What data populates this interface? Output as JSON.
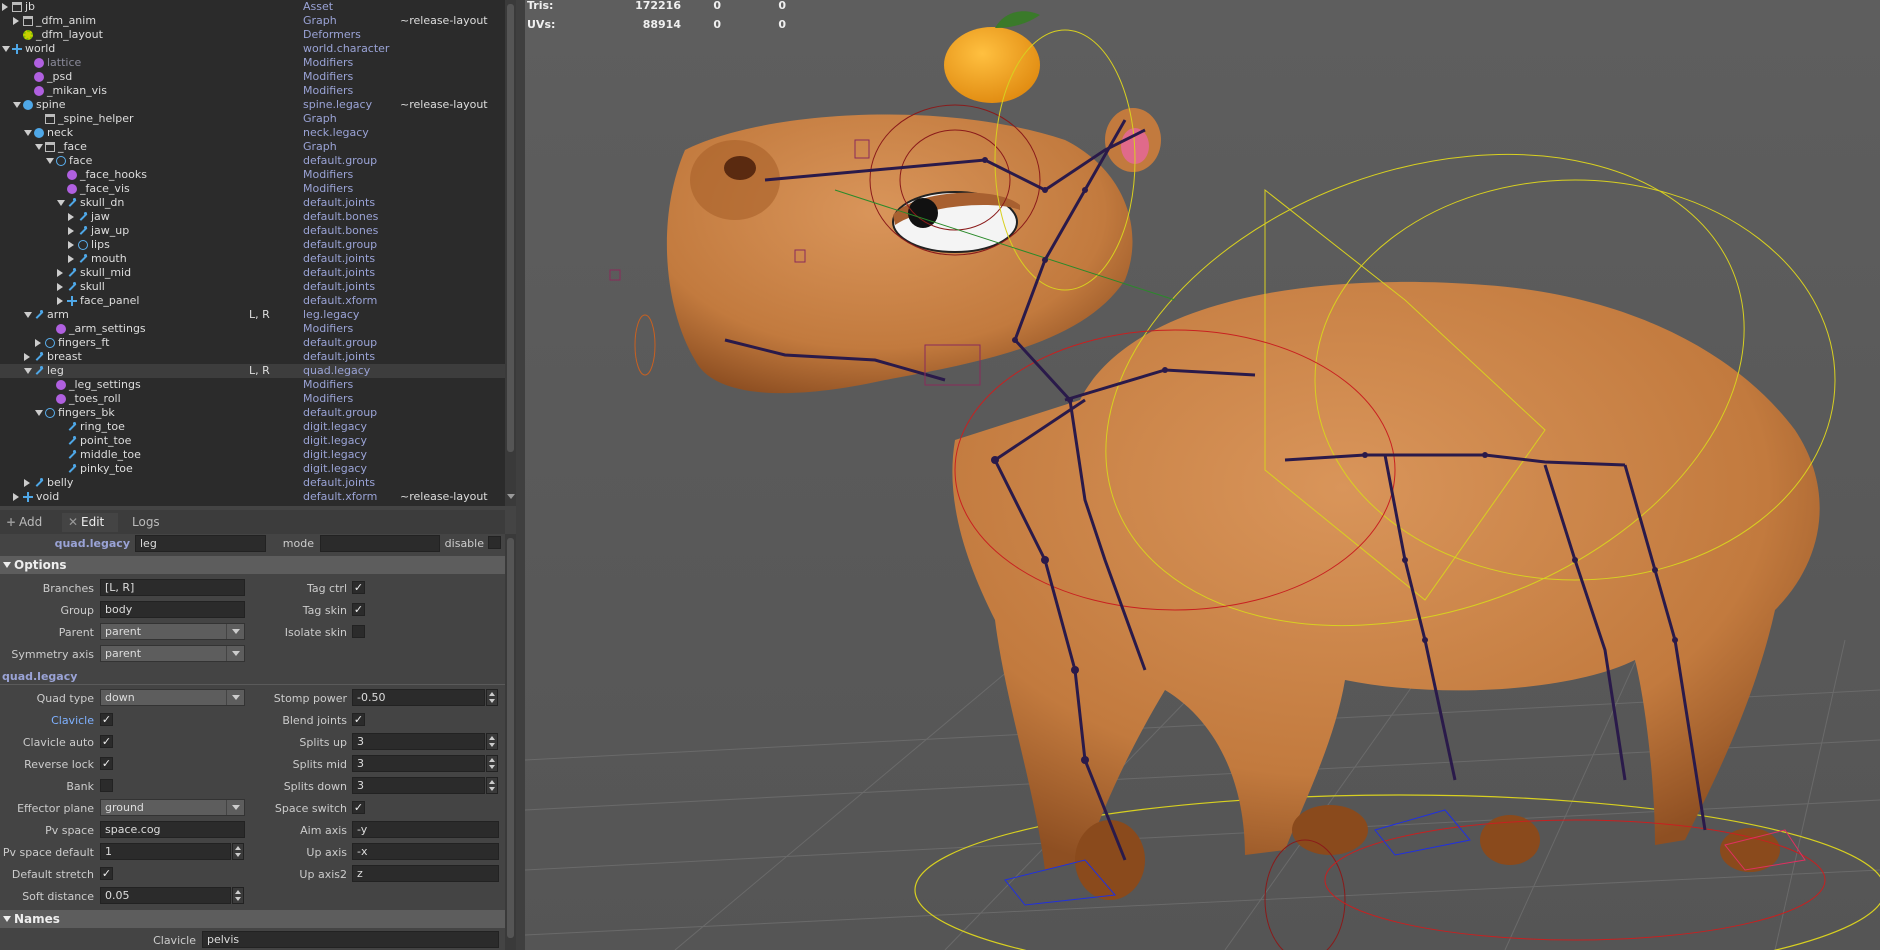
{
  "outliner": {
    "rows": [
      {
        "indent": 0,
        "tri": "closed",
        "icon": "graph",
        "name": "jb",
        "type": "Asset",
        "branches": "",
        "tag": ""
      },
      {
        "indent": 1,
        "tri": "closed",
        "icon": "graph",
        "name": "_dfm_anim",
        "type": "Graph",
        "branches": "",
        "tag": "~release-layout"
      },
      {
        "indent": 1,
        "tri": "none",
        "icon": "deform",
        "name": "_dfm_layout",
        "type": "Deformers",
        "branches": "",
        "tag": ""
      },
      {
        "indent": 0,
        "tri": "open",
        "icon": "world",
        "name": "world",
        "type": "world.character",
        "branches": "",
        "tag": ""
      },
      {
        "indent": 2,
        "tri": "none",
        "icon": "gear",
        "name": "lattice",
        "type": "Modifiers",
        "branches": "",
        "tag": "",
        "dim": true
      },
      {
        "indent": 2,
        "tri": "none",
        "icon": "gear",
        "name": "_psd",
        "type": "Modifiers",
        "branches": "",
        "tag": ""
      },
      {
        "indent": 2,
        "tri": "none",
        "icon": "gear",
        "name": "_mikan_vis",
        "type": "Modifiers",
        "branches": "",
        "tag": ""
      },
      {
        "indent": 1,
        "tri": "open",
        "icon": "spine",
        "name": "spine",
        "type": "spine.legacy",
        "branches": "",
        "tag": "~release-layout"
      },
      {
        "indent": 3,
        "tri": "none",
        "icon": "graph",
        "name": "_spine_helper",
        "type": "Graph",
        "branches": "",
        "tag": ""
      },
      {
        "indent": 2,
        "tri": "open",
        "icon": "spine",
        "name": "neck",
        "type": "neck.legacy",
        "branches": "",
        "tag": ""
      },
      {
        "indent": 3,
        "tri": "open",
        "icon": "graph",
        "name": "_face",
        "type": "Graph",
        "branches": "",
        "tag": ""
      },
      {
        "indent": 4,
        "tri": "open",
        "icon": "group",
        "name": "face",
        "type": "default.group",
        "branches": "",
        "tag": ""
      },
      {
        "indent": 5,
        "tri": "none",
        "icon": "gear",
        "name": "_face_hooks",
        "type": "Modifiers",
        "branches": "",
        "tag": ""
      },
      {
        "indent": 5,
        "tri": "none",
        "icon": "gear",
        "name": "_face_vis",
        "type": "Modifiers",
        "branches": "",
        "tag": ""
      },
      {
        "indent": 5,
        "tri": "open",
        "icon": "joint",
        "name": "skull_dn",
        "type": "default.joints",
        "branches": "",
        "tag": ""
      },
      {
        "indent": 6,
        "tri": "closed",
        "icon": "joint",
        "name": "jaw",
        "type": "default.bones",
        "branches": "",
        "tag": ""
      },
      {
        "indent": 6,
        "tri": "closed",
        "icon": "joint",
        "name": "jaw_up",
        "type": "default.bones",
        "branches": "",
        "tag": ""
      },
      {
        "indent": 6,
        "tri": "closed",
        "icon": "group",
        "name": "lips",
        "type": "default.group",
        "branches": "",
        "tag": ""
      },
      {
        "indent": 6,
        "tri": "closed",
        "icon": "joint",
        "name": "mouth",
        "type": "default.joints",
        "branches": "",
        "tag": ""
      },
      {
        "indent": 5,
        "tri": "closed",
        "icon": "joint",
        "name": "skull_mid",
        "type": "default.joints",
        "branches": "",
        "tag": ""
      },
      {
        "indent": 5,
        "tri": "closed",
        "icon": "joint",
        "name": "skull",
        "type": "default.joints",
        "branches": "",
        "tag": ""
      },
      {
        "indent": 5,
        "tri": "closed",
        "icon": "xform",
        "name": "face_panel",
        "type": "default.xform",
        "branches": "",
        "tag": ""
      },
      {
        "indent": 2,
        "tri": "open",
        "icon": "joint",
        "name": "arm",
        "type": "leg.legacy",
        "branches": "L, R",
        "tag": ""
      },
      {
        "indent": 4,
        "tri": "none",
        "icon": "gear",
        "name": "_arm_settings",
        "type": "Modifiers",
        "branches": "",
        "tag": ""
      },
      {
        "indent": 3,
        "tri": "closed",
        "icon": "group",
        "name": "fingers_ft",
        "type": "default.group",
        "branches": "",
        "tag": ""
      },
      {
        "indent": 2,
        "tri": "closed",
        "icon": "joint",
        "name": "breast",
        "type": "default.joints",
        "branches": "",
        "tag": ""
      },
      {
        "indent": 2,
        "tri": "open",
        "icon": "joint",
        "name": "leg",
        "type": "quad.legacy",
        "branches": "L, R",
        "tag": "",
        "selected": true
      },
      {
        "indent": 4,
        "tri": "none",
        "icon": "gear",
        "name": "_leg_settings",
        "type": "Modifiers",
        "branches": "",
        "tag": ""
      },
      {
        "indent": 4,
        "tri": "none",
        "icon": "gear",
        "name": "_toes_roll",
        "type": "Modifiers",
        "branches": "",
        "tag": ""
      },
      {
        "indent": 3,
        "tri": "open",
        "icon": "group",
        "name": "fingers_bk",
        "type": "default.group",
        "branches": "",
        "tag": ""
      },
      {
        "indent": 5,
        "tri": "none",
        "icon": "joint",
        "name": "ring_toe",
        "type": "digit.legacy",
        "branches": "",
        "tag": ""
      },
      {
        "indent": 5,
        "tri": "none",
        "icon": "joint",
        "name": "point_toe",
        "type": "digit.legacy",
        "branches": "",
        "tag": ""
      },
      {
        "indent": 5,
        "tri": "none",
        "icon": "joint",
        "name": "middle_toe",
        "type": "digit.legacy",
        "branches": "",
        "tag": ""
      },
      {
        "indent": 5,
        "tri": "none",
        "icon": "joint",
        "name": "pinky_toe",
        "type": "digit.legacy",
        "branches": "",
        "tag": ""
      },
      {
        "indent": 2,
        "tri": "closed",
        "icon": "joint",
        "name": "belly",
        "type": "default.joints",
        "branches": "",
        "tag": ""
      },
      {
        "indent": 1,
        "tri": "closed",
        "icon": "xform",
        "name": "void",
        "type": "default.xform",
        "branches": "",
        "tag": "~release-layout"
      }
    ]
  },
  "tabs": {
    "add": "Add",
    "edit": "Edit",
    "logs": "Logs"
  },
  "header": {
    "type": "quad.legacy",
    "name": "leg",
    "mode_label": "mode",
    "mode_value": "",
    "disable_label": "disable"
  },
  "options": {
    "title": "Options",
    "branches_label": "Branches",
    "branches_value": "[L, R]",
    "group_label": "Group",
    "group_value": "body",
    "parent_label": "Parent",
    "parent_value": "parent",
    "symmetry_label": "Symmetry axis",
    "symmetry_value": "parent",
    "tag_ctrl_label": "Tag ctrl",
    "tag_skin_label": "Tag skin",
    "isolate_skin_label": "Isolate skin",
    "tag_ctrl": true,
    "tag_skin": true,
    "isolate_skin": false
  },
  "quad": {
    "title": "quad.legacy",
    "quad_type_label": "Quad type",
    "quad_type_value": "down",
    "clavicle_label": "Clavicle",
    "clavicle_auto_label": "Clavicle auto",
    "reverse_lock_label": "Reverse lock",
    "bank_label": "Bank",
    "effector_plane_label": "Effector plane",
    "effector_plane_value": "ground",
    "pv_space_label": "Pv space",
    "pv_space_value": "space.cog",
    "pv_space_default_label": "Pv space default",
    "pv_space_default_value": "1",
    "default_stretch_label": "Default stretch",
    "soft_distance_label": "Soft distance",
    "soft_distance_value": "0.05",
    "stomp_power_label": "Stomp power",
    "stomp_power_value": "-0.50",
    "blend_joints_label": "Blend joints",
    "splits_up_label": "Splits up",
    "splits_up_value": "3",
    "splits_mid_label": "Splits mid",
    "splits_mid_value": "3",
    "splits_down_label": "Splits down",
    "splits_down_value": "3",
    "space_switch_label": "Space switch",
    "aim_axis_label": "Aim axis",
    "aim_axis_value": "-y",
    "up_axis_label": "Up axis",
    "up_axis_value": "-x",
    "up_axis2_label": "Up axis2",
    "up_axis2_value": "z"
  },
  "names": {
    "title": "Names",
    "clavicle_label": "Clavicle",
    "clavicle_value": "pelvis"
  },
  "hud": {
    "tris_label": "Tris:",
    "tris_value": "172216",
    "tris_a": "0",
    "tris_b": "0",
    "uvs_label": "UVs:",
    "uvs_value": "88914",
    "uvs_a": "0",
    "uvs_b": "0"
  },
  "colors": {
    "body": "#c97f3c",
    "body_shadow": "#8a4a1c",
    "mikan": "#f0a020",
    "leaf": "#3a7a2a",
    "rig": "#2a1a4a",
    "ground_yellow": "#d8d020"
  }
}
